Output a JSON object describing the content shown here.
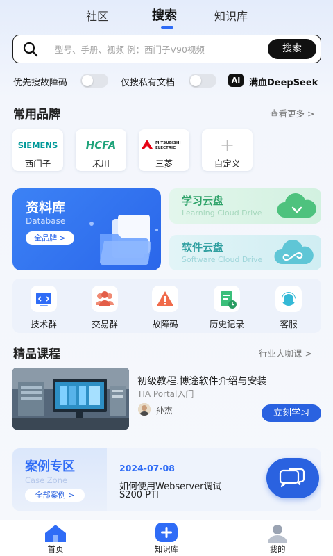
{
  "tabs": [
    {
      "label": "社区"
    },
    {
      "label": "搜索"
    },
    {
      "label": "知识库"
    }
  ],
  "search": {
    "placeholder": "型号、手册、视频 例：西门子V90视频",
    "button_label": "搜索"
  },
  "toggles": {
    "fault_priority_label": "优先搜故障码",
    "private_docs_label": "仅搜私有文档",
    "ai_badge": "AI",
    "deepseek_label": "满血DeepSeek"
  },
  "brands_section": {
    "title": "常用品牌",
    "more": "查看更多 >",
    "items": [
      {
        "name": "西门子",
        "logo_text": "SIEMENS",
        "color": "#009999"
      },
      {
        "name": "禾川",
        "logo_text": "HCFA",
        "color": "#1fa37a"
      },
      {
        "name": "三菱",
        "logo_text": "MITSUBISHI ELECTRIC",
        "color": "#e60012"
      },
      {
        "name": "自定义",
        "logo_text": "+",
        "color": "#bbbbbb"
      }
    ]
  },
  "database_card": {
    "title": "资料库",
    "subtitle": "Database",
    "button": "全品牌 >"
  },
  "learning_card": {
    "title": "学习云盘",
    "subtitle": "Learning Cloud Drive"
  },
  "software_card": {
    "title": "软件云盘",
    "subtitle": "Software Cloud Drive"
  },
  "tools": [
    {
      "label": "技术群",
      "icon": "code-window-icon"
    },
    {
      "label": "交易群",
      "icon": "people-group-icon"
    },
    {
      "label": "故障码",
      "icon": "warning-icon"
    },
    {
      "label": "历史记录",
      "icon": "history-doc-icon"
    },
    {
      "label": "客服",
      "icon": "customer-service-icon"
    }
  ],
  "courses_section": {
    "title": "精品课程",
    "more": "行业大咖课 >"
  },
  "course": {
    "title": "初级教程.博途软件介绍与安装",
    "subtitle": "TIA Portal入门",
    "author": "孙杰",
    "button": "立刻学习"
  },
  "case_zone": {
    "title": "案例专区",
    "subtitle": "Case Zone",
    "button": "全部案例 >",
    "date": "2024-07-08",
    "line1": "如何使用Webserver调试",
    "line2": "S200 PTI"
  },
  "bottom_nav": [
    {
      "label": "首页",
      "icon": "home-icon"
    },
    {
      "label": "知识库",
      "icon": "plus-icon"
    },
    {
      "label": "我的",
      "icon": "profile-icon"
    }
  ],
  "colors": {
    "accent": "#2f6cf6",
    "green": "#2fa36a"
  }
}
